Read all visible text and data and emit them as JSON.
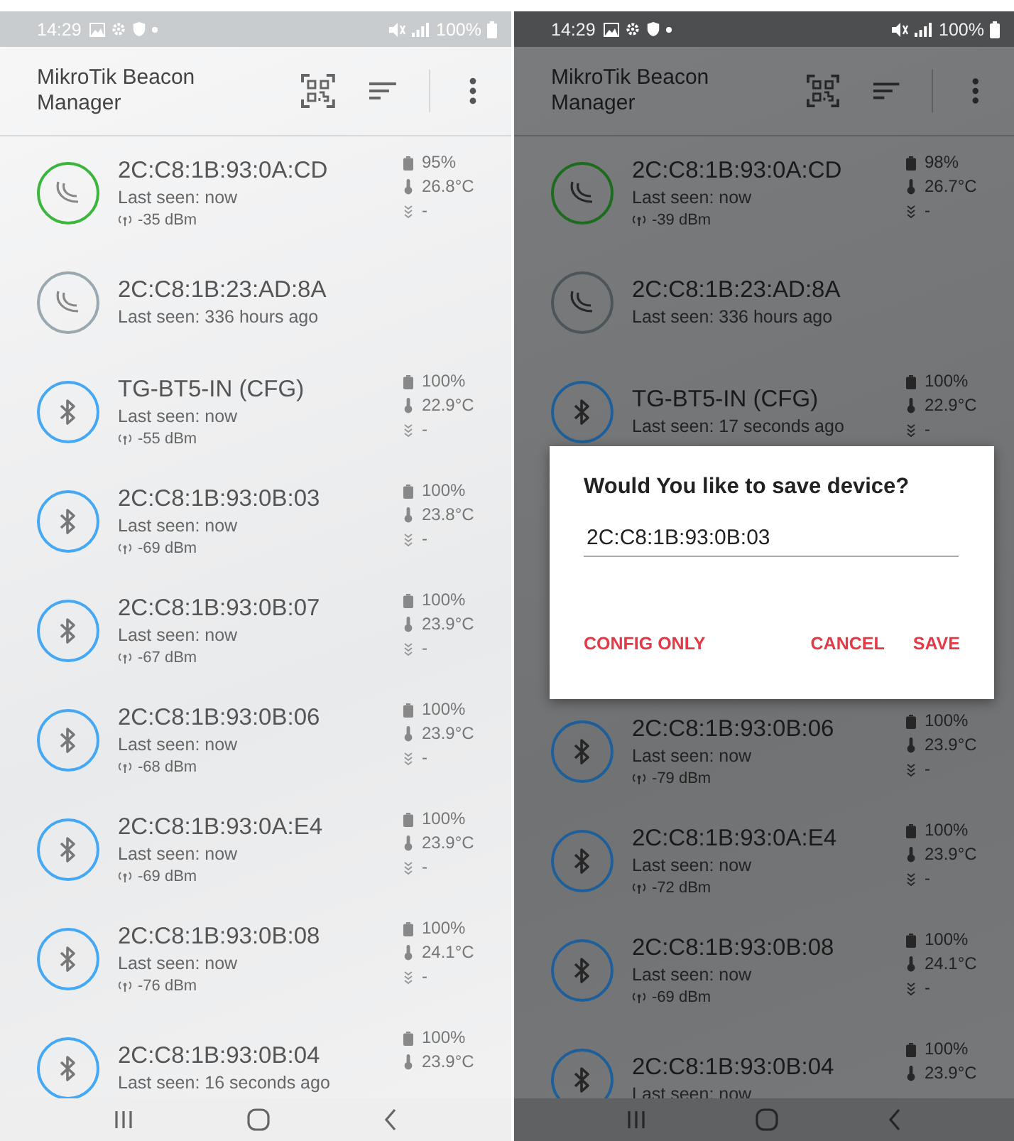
{
  "screens": [
    {
      "status_bar": {
        "time": "14:29",
        "battery": "100%"
      },
      "title": "MikroTik Beacon Manager",
      "devices": [
        {
          "kind": "mikrotik",
          "color": "#3cb53c",
          "mac": "2C:C8:1B:93:0A:CD",
          "last_seen": "Last seen: now",
          "rssi": "-35 dBm",
          "battery": "95%",
          "temperature": "26.8°C",
          "motion": "-"
        },
        {
          "kind": "mikrotik",
          "color": "#9aa8b0",
          "mac": "2C:C8:1B:23:AD:8A",
          "last_seen": "Last seen: 336 hours ago"
        },
        {
          "kind": "bluetooth",
          "color": "#45a8f5",
          "mac": "TG-BT5-IN (CFG)",
          "last_seen": "Last seen: now",
          "rssi": "-55 dBm",
          "battery": "100%",
          "temperature": "22.9°C",
          "motion": "-"
        },
        {
          "kind": "bluetooth",
          "color": "#45a8f5",
          "mac": "2C:C8:1B:93:0B:03",
          "last_seen": "Last seen: now",
          "rssi": "-69 dBm",
          "battery": "100%",
          "temperature": "23.8°C",
          "motion": "-"
        },
        {
          "kind": "bluetooth",
          "color": "#45a8f5",
          "mac": "2C:C8:1B:93:0B:07",
          "last_seen": "Last seen: now",
          "rssi": "-67 dBm",
          "battery": "100%",
          "temperature": "23.9°C",
          "motion": "-"
        },
        {
          "kind": "bluetooth",
          "color": "#45a8f5",
          "mac": "2C:C8:1B:93:0B:06",
          "last_seen": "Last seen: now",
          "rssi": "-68 dBm",
          "battery": "100%",
          "temperature": "23.9°C",
          "motion": "-"
        },
        {
          "kind": "bluetooth",
          "color": "#45a8f5",
          "mac": "2C:C8:1B:93:0A:E4",
          "last_seen": "Last seen: now",
          "rssi": "-69 dBm",
          "battery": "100%",
          "temperature": "23.9°C",
          "motion": "-"
        },
        {
          "kind": "bluetooth",
          "color": "#45a8f5",
          "mac": "2C:C8:1B:93:0B:08",
          "last_seen": "Last seen: now",
          "rssi": "-76 dBm",
          "battery": "100%",
          "temperature": "24.1°C",
          "motion": "-"
        },
        {
          "kind": "bluetooth",
          "color": "#45a8f5",
          "mac": "2C:C8:1B:93:0B:04",
          "last_seen": "Last seen: 16 seconds ago",
          "battery": "100%",
          "temperature": "23.9°C"
        }
      ]
    },
    {
      "status_bar": {
        "time": "14:29",
        "battery": "100%"
      },
      "title": "MikroTik Beacon Manager",
      "devices": [
        {
          "kind": "mikrotik",
          "color": "#1d6b1d",
          "mac": "2C:C8:1B:93:0A:CD",
          "last_seen": "Last seen: now",
          "rssi": "-39 dBm",
          "battery": "98%",
          "temperature": "26.7°C",
          "motion": "-"
        },
        {
          "kind": "mikrotik",
          "color": "#4b555a",
          "mac": "2C:C8:1B:23:AD:8A",
          "last_seen": "Last seen: 336 hours ago"
        },
        {
          "kind": "bluetooth",
          "color": "#1f5f99",
          "mac": "TG-BT5-IN (CFG)",
          "last_seen": "Last seen: 17 seconds ago",
          "battery": "100%",
          "temperature": "22.9°C",
          "motion": "-"
        },
        {
          "kind": "bluetooth",
          "color": "#1f5f99",
          "mac": "2C:C8:1B:93:0B:06",
          "last_seen": "Last seen: now",
          "rssi": "-79 dBm",
          "battery": "100%",
          "temperature": "23.9°C",
          "motion": "-"
        },
        {
          "kind": "bluetooth",
          "color": "#1f5f99",
          "mac": "2C:C8:1B:93:0A:E4",
          "last_seen": "Last seen: now",
          "rssi": "-72 dBm",
          "battery": "100%",
          "temperature": "23.9°C",
          "motion": "-"
        },
        {
          "kind": "bluetooth",
          "color": "#1f5f99",
          "mac": "2C:C8:1B:93:0B:08",
          "last_seen": "Last seen: now",
          "rssi": "-69 dBm",
          "battery": "100%",
          "temperature": "24.1°C",
          "motion": "-"
        },
        {
          "kind": "bluetooth",
          "color": "#1f5f99",
          "mac": "2C:C8:1B:93:0B:04",
          "last_seen": "Last seen: now",
          "battery": "100%",
          "temperature": "23.9°C"
        }
      ],
      "dialog": {
        "title": "Would You like to save device?",
        "value": "2C:C8:1B:93:0B:03",
        "buttons": [
          "CONFIG ONLY",
          "CANCEL",
          "SAVE"
        ]
      }
    }
  ]
}
